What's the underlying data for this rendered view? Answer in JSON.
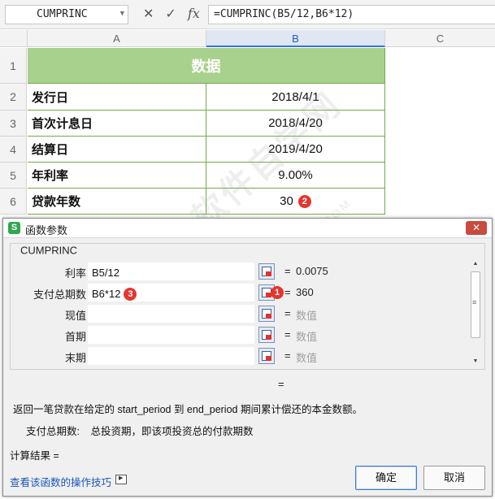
{
  "formula_bar": {
    "name_box": "CUMPRINC",
    "cancel_icon": "✕",
    "confirm_icon": "✓",
    "fx_label": "fx",
    "formula": "=CUMPRINC(B5/12,B6*12)"
  },
  "sheet": {
    "columns": [
      "A",
      "B",
      "C"
    ],
    "rows": [
      "1",
      "2",
      "3",
      "4",
      "5",
      "6"
    ],
    "title": "数据",
    "cells": [
      {
        "label": "发行日",
        "value": "2018/4/1"
      },
      {
        "label": "首次计息日",
        "value": "2018/4/20"
      },
      {
        "label": "结算日",
        "value": "2019/4/20"
      },
      {
        "label": "年利率",
        "value": "9.00%"
      },
      {
        "label": "贷款年数",
        "value": "30"
      }
    ]
  },
  "badges": {
    "one": "1",
    "two": "2",
    "three": "3"
  },
  "dialog": {
    "title": "函数参数",
    "logo_letter": "S",
    "close_icon": "✕",
    "function_name": "CUMPRINC",
    "args": [
      {
        "label": "利率",
        "value": "B5/12",
        "result": "0.0075",
        "placeholder": false
      },
      {
        "label": "支付总期数",
        "value": "B6*12",
        "result": "360",
        "placeholder": false
      },
      {
        "label": "现值",
        "value": "",
        "result": "数值",
        "placeholder": true
      },
      {
        "label": "首期",
        "value": "",
        "result": "数值",
        "placeholder": true
      },
      {
        "label": "末期",
        "value": "",
        "result": "数值",
        "placeholder": true
      }
    ],
    "equals": "=",
    "result_equals": "=",
    "description": "返回一笔贷款在给定的 start_period 到 end_period 期间累计偿还的本金数额。",
    "param_name": "支付总期数:",
    "param_desc": "总投资期，即该项投资总的付款期数",
    "calc_result": "计算结果 =",
    "tips_link": "查看该函数的操作技巧",
    "ok_label": "确定",
    "cancel_label": "取消"
  },
  "watermark": {
    "main": "软件自学网",
    "sub": "WWW.RJZXW.COM"
  }
}
